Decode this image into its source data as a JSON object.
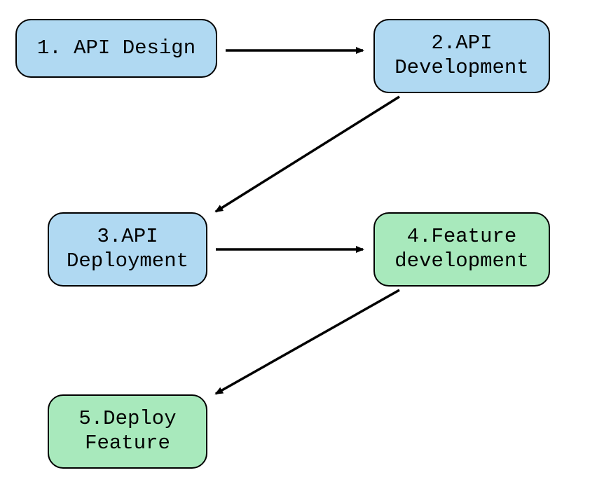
{
  "nodes": {
    "n1": {
      "label": "1. API Design",
      "color": "blue"
    },
    "n2": {
      "label": "2.API Development",
      "color": "blue"
    },
    "n3": {
      "label": "3.API Deployment",
      "color": "blue"
    },
    "n4": {
      "label": "4.Feature development",
      "color": "green"
    },
    "n5": {
      "label": "5.Deploy Feature",
      "color": "green"
    }
  },
  "edges": [
    {
      "from": "n1",
      "to": "n2"
    },
    {
      "from": "n2",
      "to": "n3"
    },
    {
      "from": "n3",
      "to": "n4"
    },
    {
      "from": "n4",
      "to": "n5"
    }
  ],
  "colors": {
    "blue": "#b0d9f2",
    "green": "#a8e9bc",
    "stroke": "#000000"
  }
}
